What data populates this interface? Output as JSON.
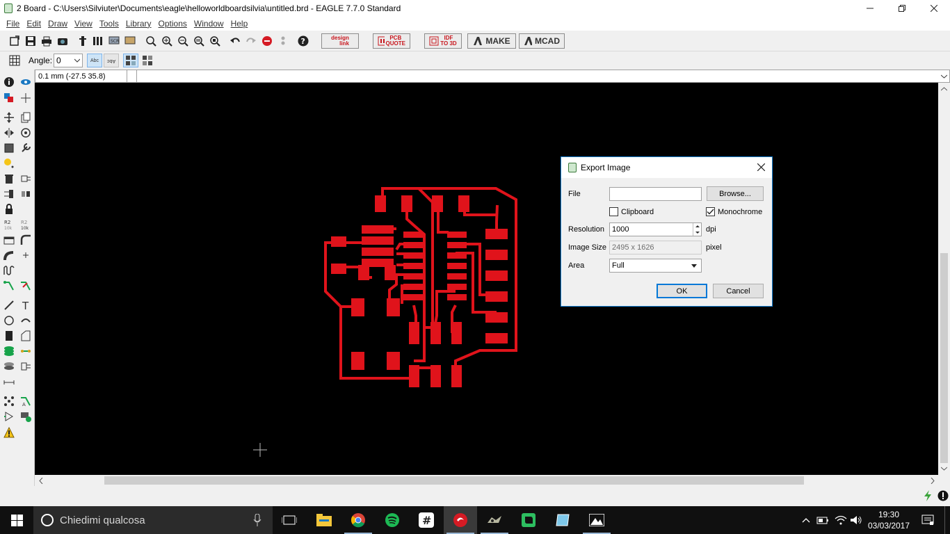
{
  "window": {
    "title": "2 Board - C:\\Users\\Silviuter\\Documents\\eagle\\helloworldboardsilvia\\untitled.brd - EAGLE 7.7.0 Standard",
    "minimize_icon": "minimize-icon",
    "maximize_icon": "restore-icon",
    "close_icon": "close-icon"
  },
  "menu": {
    "items": [
      "File",
      "Edit",
      "Draw",
      "View",
      "Tools",
      "Library",
      "Options",
      "Window",
      "Help"
    ]
  },
  "toolbar": {
    "design_link": {
      "line1": "design",
      "line2": "link"
    },
    "pcb_quote": {
      "line1": "PCB",
      "line2": "QUOTE"
    },
    "idf_3d": {
      "line1": "IDF",
      "line2": "TO 3D"
    },
    "make_label": "MAKE",
    "mcad_label": "MCAD"
  },
  "param_bar": {
    "angle_label": "Angle:",
    "angle_value": "0",
    "text_orient_1": "Abc",
    "text_orient_2": "Abc"
  },
  "command_line": {
    "coords": "0.1 mm (-27.5 35.8)",
    "value": ""
  },
  "dialog": {
    "title": "Export Image",
    "file_label": "File",
    "file_value": "",
    "browse_label": "Browse...",
    "clipboard_label": "Clipboard",
    "clipboard_checked": false,
    "monochrome_label": "Monochrome",
    "monochrome_checked": true,
    "resolution_label": "Resolution",
    "resolution_value": "1000",
    "resolution_unit": "dpi",
    "image_size_label": "Image Size",
    "image_size_value": "2495 x 1626",
    "image_size_unit": "pixel",
    "area_label": "Area",
    "area_value": "Full",
    "ok_label": "OK",
    "cancel_label": "Cancel"
  },
  "taskbar": {
    "search_placeholder": "Chiedimi qualcosa",
    "time": "19:30",
    "date": "03/03/2017"
  },
  "colors": {
    "trace": "#e0131b",
    "canvas": "#000000",
    "accent": "#0078d7"
  }
}
